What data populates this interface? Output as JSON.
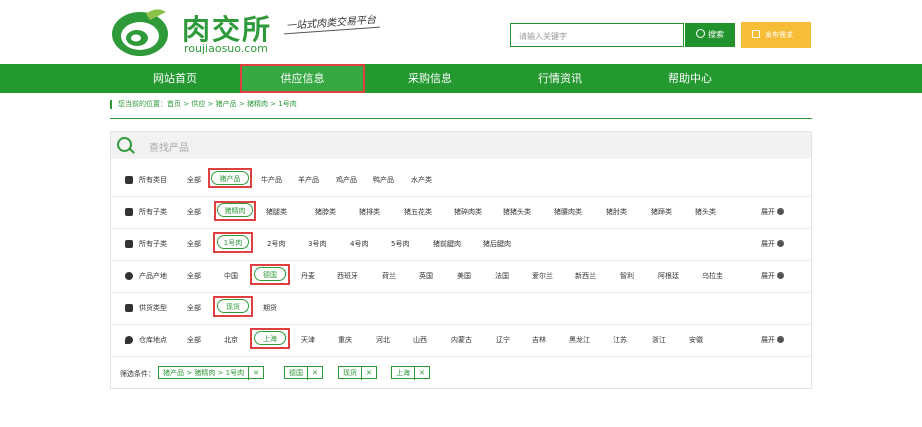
{
  "header": {
    "brand": "肉交所",
    "domain": "roujiaosuo.com",
    "slogan": "一站式肉类交易平台",
    "search": {
      "placeholder": "请输入关键字",
      "button": "搜索"
    },
    "publish": "发布需求"
  },
  "nav": [
    "网站首页",
    "供应信息",
    "采购信息",
    "行情资讯",
    "帮助中心"
  ],
  "breadcrumb": "您当前的位置：首页 > 供应 > 猪产品 > 猪精肉 > 1号肉",
  "panel": {
    "find": "查找产品",
    "expand": "展开",
    "rows": [
      {
        "label": "所有类目",
        "options": [
          "全部",
          "猪产品",
          "牛产品",
          "羊产品",
          "鸡产品",
          "鸭产品",
          "水产类"
        ]
      },
      {
        "label": "所有子类",
        "options": [
          "全部",
          "猪精肉",
          "猪腿类",
          "猪脖类",
          "猪排类",
          "猪五花类",
          "猪碎肉类",
          "猪猪头类",
          "猪腰肉类",
          "猪肘类",
          "猪蹄类",
          "猪头类"
        ]
      },
      {
        "label": "所有子类",
        "options": [
          "全部",
          "1号肉",
          "2号肉",
          "3号肉",
          "4号肉",
          "5号肉",
          "猪前腱肉",
          "猪后腱肉"
        ]
      },
      {
        "label": "产品产地",
        "options": [
          "全部",
          "中国",
          "德国",
          "丹麦",
          "西班牙",
          "荷兰",
          "英国",
          "美国",
          "法国",
          "爱尔兰",
          "新西兰",
          "智利",
          "阿根廷",
          "乌拉圭"
        ]
      },
      {
        "label": "供货类型",
        "options": [
          "全部",
          "现货",
          "期货"
        ]
      },
      {
        "label": "仓库地点",
        "options": [
          "全部",
          "北京",
          "上海",
          "天津",
          "重庆",
          "河北",
          "山西",
          "内蒙古",
          "辽宁",
          "吉林",
          "黑龙江",
          "江苏",
          "浙江",
          "安徽"
        ]
      }
    ]
  },
  "filter": {
    "label": "筛选条件：",
    "tags": [
      "猪产品 > 猪精肉 > 1号肉",
      "德国",
      "现货",
      "上海"
    ],
    "remove": "✕"
  },
  "colors": {
    "brand_green": "#239930",
    "highlight_red": "#e03f3f",
    "publish_orange": "#f8bd36"
  }
}
